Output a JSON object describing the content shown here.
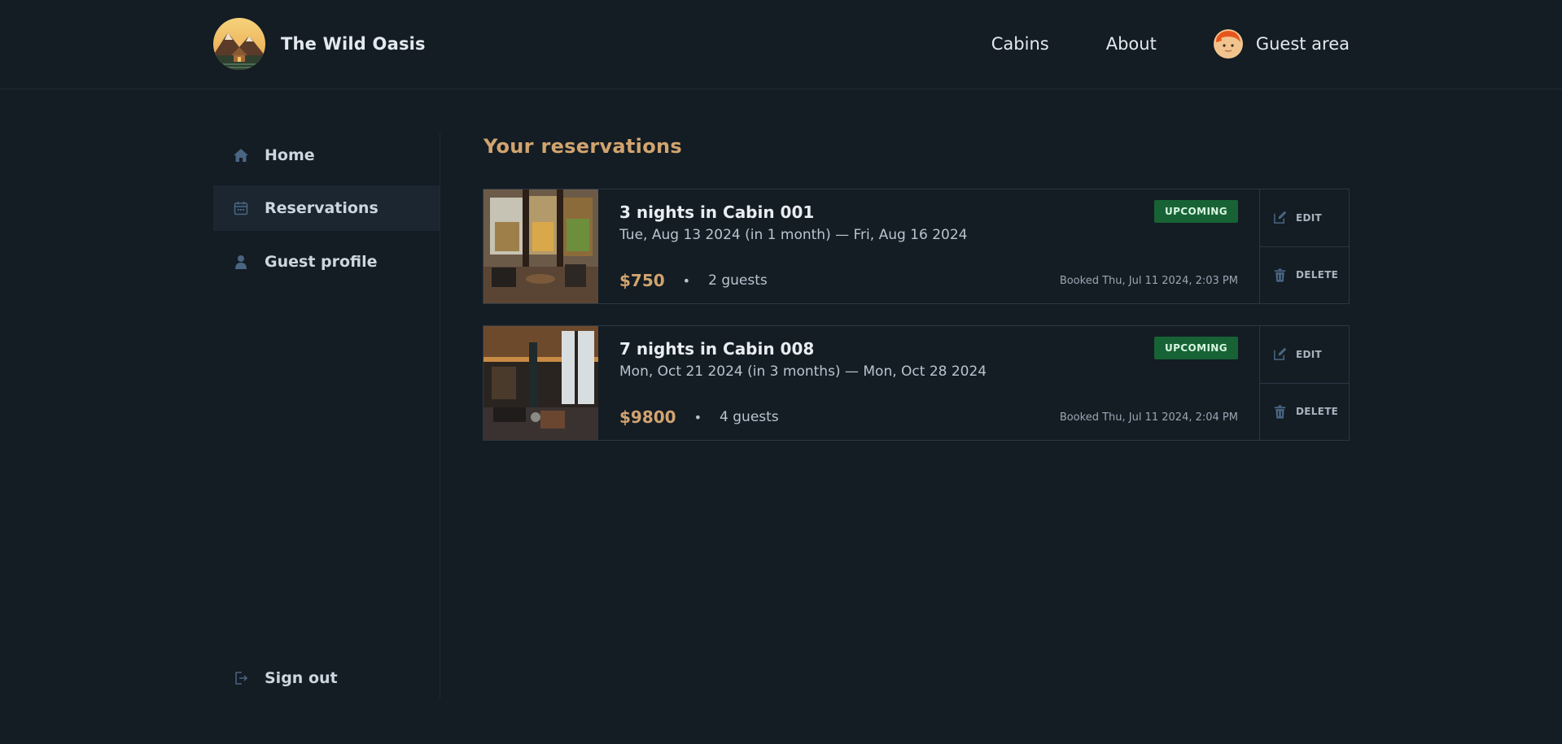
{
  "header": {
    "brand": "The Wild Oasis",
    "nav": {
      "cabins": "Cabins",
      "about": "About",
      "guest_area": "Guest area"
    }
  },
  "sidebar": {
    "items": [
      {
        "label": "Home",
        "icon": "home-icon"
      },
      {
        "label": "Reservations",
        "icon": "calendar-icon",
        "active": true
      },
      {
        "label": "Guest profile",
        "icon": "user-icon"
      }
    ],
    "sign_out": {
      "label": "Sign out",
      "icon": "sign-out-icon"
    }
  },
  "main": {
    "title": "Your reservations",
    "reservations": [
      {
        "title": "3 nights in Cabin 001",
        "dates": "Tue, Aug 13 2024 (in 1 month) — Fri, Aug 16 2024",
        "price": "$750",
        "separator": "•",
        "guests": "2 guests",
        "status": "UPCOMING",
        "booked": "Booked Thu, Jul 11 2024, 2:03 PM",
        "edit_label": "EDIT",
        "delete_label": "DELETE"
      },
      {
        "title": "7 nights in Cabin 008",
        "dates": "Mon, Oct 21 2024 (in 3 months) — Mon, Oct 28 2024",
        "price": "$9800",
        "separator": "•",
        "guests": "4 guests",
        "status": "UPCOMING",
        "booked": "Booked Thu, Jul 11 2024, 2:04 PM",
        "edit_label": "EDIT",
        "delete_label": "DELETE"
      }
    ]
  },
  "colors": {
    "background": "#141c24",
    "accent": "#d1a46e",
    "badge_bg": "#176335",
    "active_item_bg": "#1b2631"
  }
}
